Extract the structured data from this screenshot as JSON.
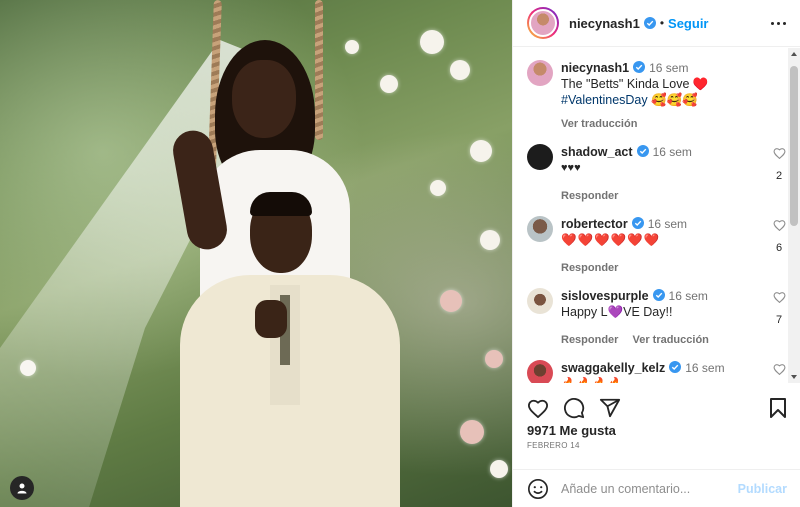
{
  "post": {
    "photo_alt": "Wedding photo",
    "user_tag_icon": "user-tag-icon"
  },
  "header": {
    "username": "niecynash1",
    "dot": "•",
    "follow_label": "Seguir"
  },
  "caption": {
    "username": "niecynash1",
    "time": "16 sem",
    "text": "The \"Betts\" Kinda Love ♥️",
    "hashtag": "#ValentinesDay",
    "emojis": "🥰🥰🥰",
    "translate_label": "Ver traducción"
  },
  "comments": [
    {
      "username": "shadow_act",
      "time": "16 sem",
      "text": "♥♥♥",
      "reply_label": "Responder",
      "likes": "2"
    },
    {
      "username": "robertector",
      "time": "16 sem",
      "text": "❤️❤️❤️❤️❤️❤️",
      "reply_label": "Responder",
      "likes": "6"
    },
    {
      "username": "sislovespurple",
      "time": "16 sem",
      "text": "Happy L💜VE Day!!",
      "reply_label": "Responder",
      "translate_label": "Ver traducción",
      "likes": "7"
    },
    {
      "username": "swaggakelly_kelz",
      "time": "16 sem",
      "text": "🔥🔥🔥🔥"
    }
  ],
  "footer": {
    "likes": "9971 Me gusta",
    "date": "Febrero 14",
    "comment_placeholder": "Añade un comentario...",
    "publish_label": "Publicar"
  },
  "colors": {
    "accent": "#0095f6",
    "verified": "#3897f0",
    "like_red": "#ed4956",
    "hashtag": "#00376b",
    "publish_disabled": "#b3dbff"
  }
}
